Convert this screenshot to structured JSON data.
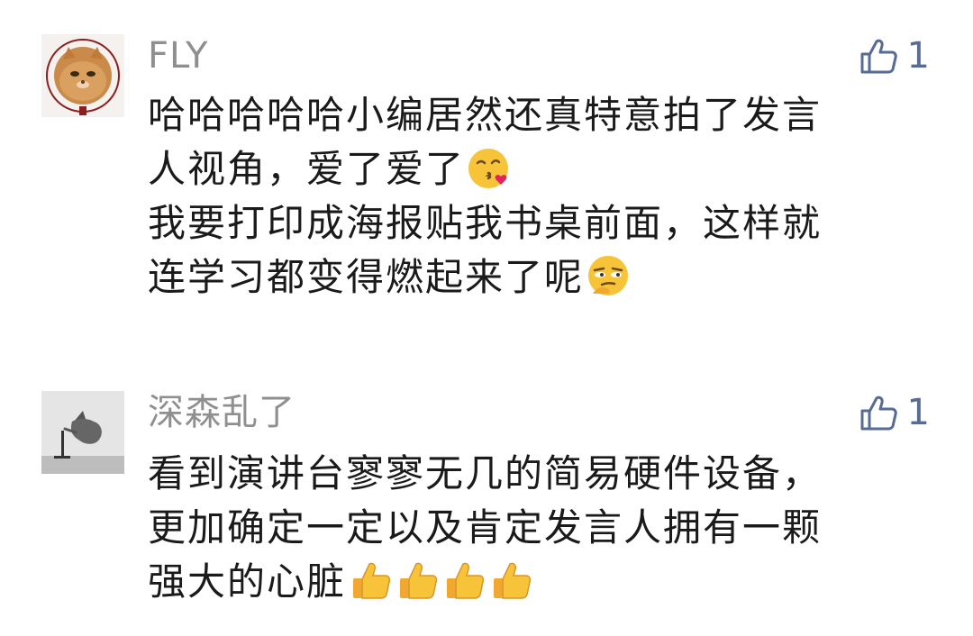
{
  "comments": [
    {
      "username": "FLY",
      "likes": "1",
      "avatar_icon": "cat-seal-avatar",
      "lines": [
        "哈哈哈哈哈小编居然还真特意拍了发言",
        "人视角，爱了爱了",
        "我要打印成海报贴我书桌前面，这样就",
        "连学习都变得燃起来了呢"
      ],
      "emojis": [
        "face-blowing-kiss-icon",
        "face-with-monocle-thinking-icon"
      ]
    },
    {
      "username": "深森乱了",
      "likes": "1",
      "avatar_icon": "witch-shadow-avatar",
      "lines": [
        "看到演讲台寥寥无几的简易硬件设备，",
        "更加确定一定以及肯定发言人拥有一颗",
        "强大的心脏"
      ],
      "emojis": [
        "thumbs-up-icon",
        "thumbs-up-icon",
        "thumbs-up-icon",
        "thumbs-up-icon"
      ]
    }
  ],
  "colors": {
    "username": "#8f8f8f",
    "like_accent": "#576b95",
    "text": "#1a1a1a"
  }
}
